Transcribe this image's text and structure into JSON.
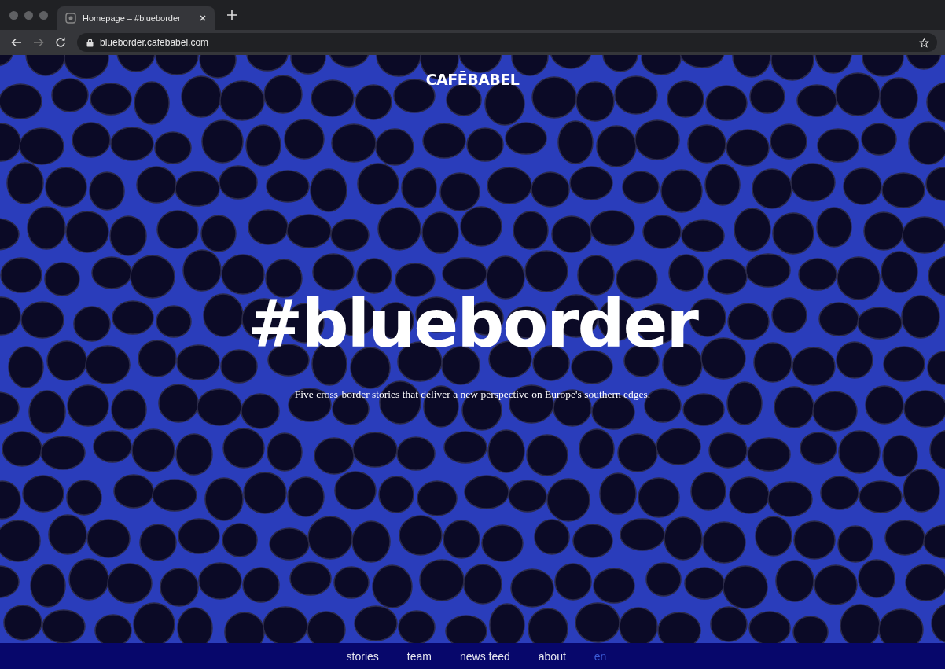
{
  "browser": {
    "tab_title": "Homepage – #blueborder",
    "url": "blueborder.cafebabel.com"
  },
  "hero": {
    "logo": "CAFĒBABEL",
    "title": "#blueborder",
    "subtitle": "Five cross-border stories that deliver a new perspective on Europe's southern edges."
  },
  "nav": [
    {
      "label": "stories",
      "selected": false
    },
    {
      "label": "team",
      "selected": false
    },
    {
      "label": "news feed",
      "selected": false
    },
    {
      "label": "about",
      "selected": false
    },
    {
      "label": "en",
      "selected": true
    }
  ]
}
